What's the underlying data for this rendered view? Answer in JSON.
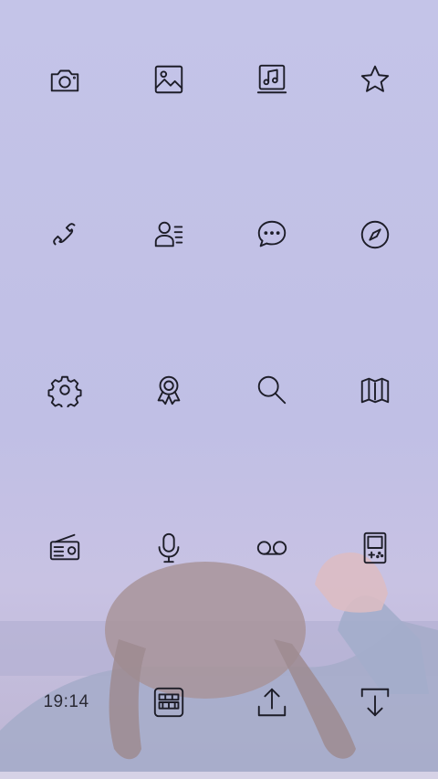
{
  "status": {
    "time": "19:14"
  },
  "icons": {
    "row1": [
      "camera-icon",
      "gallery-icon",
      "music-icon",
      "star-icon"
    ],
    "row2": [
      "phone-icon",
      "contacts-icon",
      "messages-icon",
      "compass-icon"
    ],
    "row3": [
      "settings-icon",
      "award-icon",
      "search-icon",
      "map-icon"
    ],
    "row4": [
      "radio-icon",
      "microphone-icon",
      "voicemail-icon",
      "game-console-icon"
    ],
    "dock": [
      "clock",
      "app-drawer-icon",
      "share-upload-icon",
      "download-icon"
    ]
  },
  "colors": {
    "icon_stroke": "#1d1d28",
    "background": "#c2c1e5"
  }
}
